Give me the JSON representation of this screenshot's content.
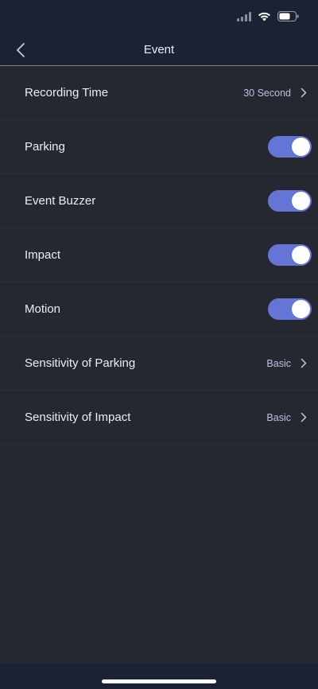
{
  "nav": {
    "title": "Event"
  },
  "settings": {
    "recording_time": {
      "label": "Recording Time",
      "value": "30 Second"
    },
    "parking": {
      "label": "Parking",
      "enabled": true
    },
    "event_buzzer": {
      "label": "Event Buzzer",
      "enabled": true
    },
    "impact": {
      "label": "Impact",
      "enabled": true
    },
    "motion": {
      "label": "Motion",
      "enabled": true
    },
    "sensitivity_parking": {
      "label": "Sensitivity of Parking",
      "value": "Basic"
    },
    "sensitivity_impact": {
      "label": "Sensitivity of Impact",
      "value": "Basic"
    }
  },
  "colors": {
    "toggle_on": "#6575d6",
    "value_text": "#b8c0e6",
    "background": "#252830",
    "header": "#1b2333"
  }
}
